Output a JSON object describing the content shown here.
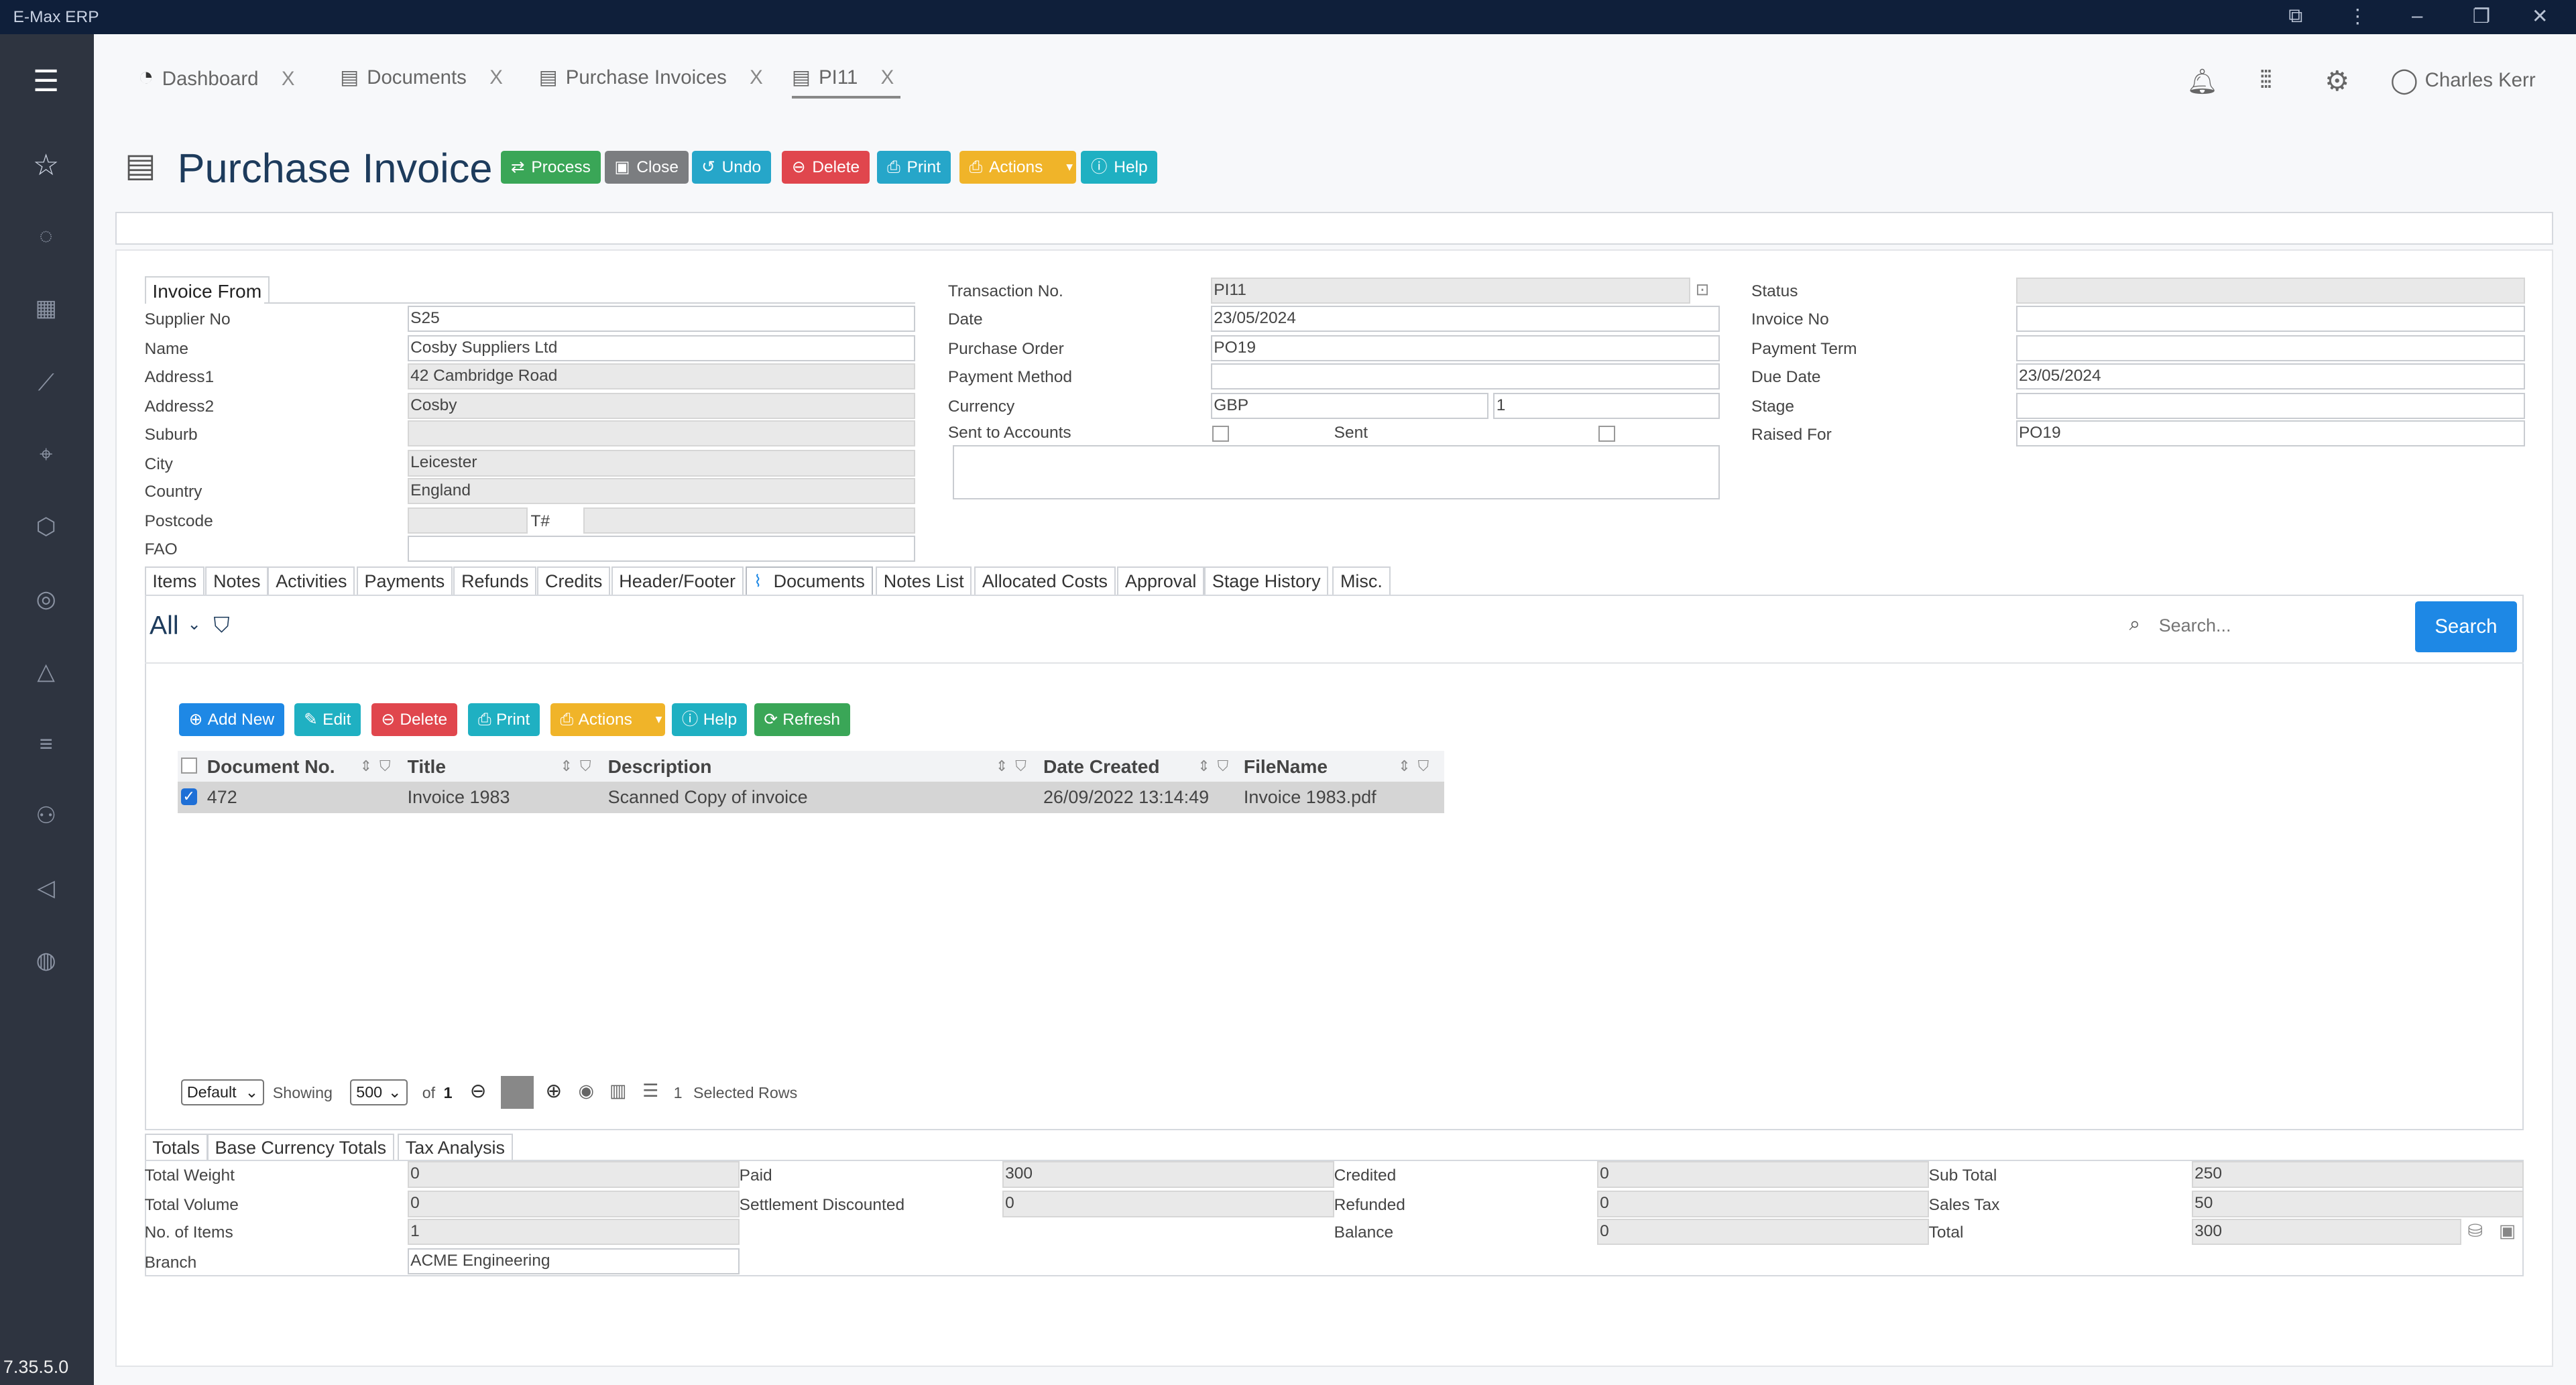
{
  "window": {
    "app_title": "E-Max ERP",
    "version": "7.35.5.0"
  },
  "tabs": [
    {
      "label": "Dashboard",
      "close": "X"
    },
    {
      "label": "Documents",
      "close": "X"
    },
    {
      "label": "Purchase Invoices",
      "close": "X"
    },
    {
      "label": "PI11",
      "close": "X"
    }
  ],
  "user": {
    "name": "Charles Kerr"
  },
  "page": {
    "title": "Purchase Invoice"
  },
  "toolbar": {
    "process": "Process",
    "close": "Close",
    "undo": "Undo",
    "delete": "Delete",
    "print": "Print",
    "actions": "Actions",
    "help": "Help"
  },
  "supplier": {
    "section": "Invoice From",
    "labels": {
      "supplier_no": "Supplier No",
      "name": "Name",
      "address1": "Address1",
      "address2": "Address2",
      "suburb": "Suburb",
      "city": "City",
      "country": "Country",
      "postcode": "Postcode",
      "fao": "FAO",
      "t_hash": "T#"
    },
    "values": {
      "supplier_no": "S25",
      "name": "Cosby Suppliers Ltd",
      "address1": "42 Cambridge Road",
      "address2": "Cosby",
      "suburb": "",
      "city": "Leicester",
      "country": "England",
      "postcode": "",
      "fao": ""
    }
  },
  "transaction": {
    "labels": {
      "transaction_no": "Transaction No.",
      "date": "Date",
      "purchase_order": "Purchase Order",
      "payment_method": "Payment Method",
      "currency": "Currency",
      "sent_to_accounts": "Sent to Accounts",
      "sent": "Sent"
    },
    "values": {
      "transaction_no": "PI11",
      "date": "23/05/2024",
      "purchase_order": "PO19",
      "payment_method": "",
      "currency": "GBP",
      "rate": "1"
    }
  },
  "status": {
    "labels": {
      "status": "Status",
      "invoice_no": "Invoice No",
      "payment_term": "Payment Term",
      "due_date": "Due Date",
      "stage": "Stage",
      "raised_for": "Raised For"
    },
    "values": {
      "status": "",
      "invoice_no": "",
      "payment_term": "",
      "due_date": "23/05/2024",
      "stage": "",
      "raised_for": "PO19"
    }
  },
  "content_tabs": [
    "Items",
    "Notes",
    "Activities",
    "Payments",
    "Refunds",
    "Credits",
    "Header/Footer",
    "Documents",
    "Notes List",
    "Allocated Costs",
    "Approval",
    "Stage History",
    "Misc."
  ],
  "active_content_tab": "Documents",
  "filter": {
    "all": "All",
    "search_placeholder": "Search...",
    "search_button": "Search"
  },
  "grid_toolbar": {
    "add_new": "Add New",
    "edit": "Edit",
    "delete": "Delete",
    "print": "Print",
    "actions": "Actions",
    "help": "Help",
    "refresh": "Refresh"
  },
  "grid": {
    "columns": [
      "Document No.",
      "Title",
      "Description",
      "Date Created",
      "FileName"
    ],
    "rows": [
      {
        "document_no": "472",
        "title": "Invoice 1983",
        "description": "Scanned Copy of invoice",
        "date_created": "26/09/2022 13:14:49",
        "filename": "Invoice 1983.pdf",
        "selected": true
      }
    ]
  },
  "pager": {
    "view": "Default",
    "showing": "Showing",
    "page_size": "500",
    "of": "of",
    "pages": "1",
    "selected_count": "1",
    "selected_label": "Selected Rows"
  },
  "totals_tabs": [
    "Totals",
    "Base Currency Totals",
    "Tax Analysis"
  ],
  "totals": {
    "labels": {
      "total_weight": "Total Weight",
      "total_volume": "Total Volume",
      "no_of_items": "No. of Items",
      "branch": "Branch",
      "paid": "Paid",
      "settlement_discounted": "Settlement Discounted",
      "credited": "Credited",
      "refunded": "Refunded",
      "balance": "Balance",
      "sub_total": "Sub Total",
      "sales_tax": "Sales Tax",
      "total": "Total"
    },
    "values": {
      "total_weight": "0",
      "total_volume": "0",
      "no_of_items": "1",
      "branch": "ACME Engineering",
      "paid": "300",
      "settlement_discounted": "0",
      "credited": "0",
      "refunded": "0",
      "balance": "0",
      "sub_total": "250",
      "sales_tax": "50",
      "total": "300"
    }
  }
}
